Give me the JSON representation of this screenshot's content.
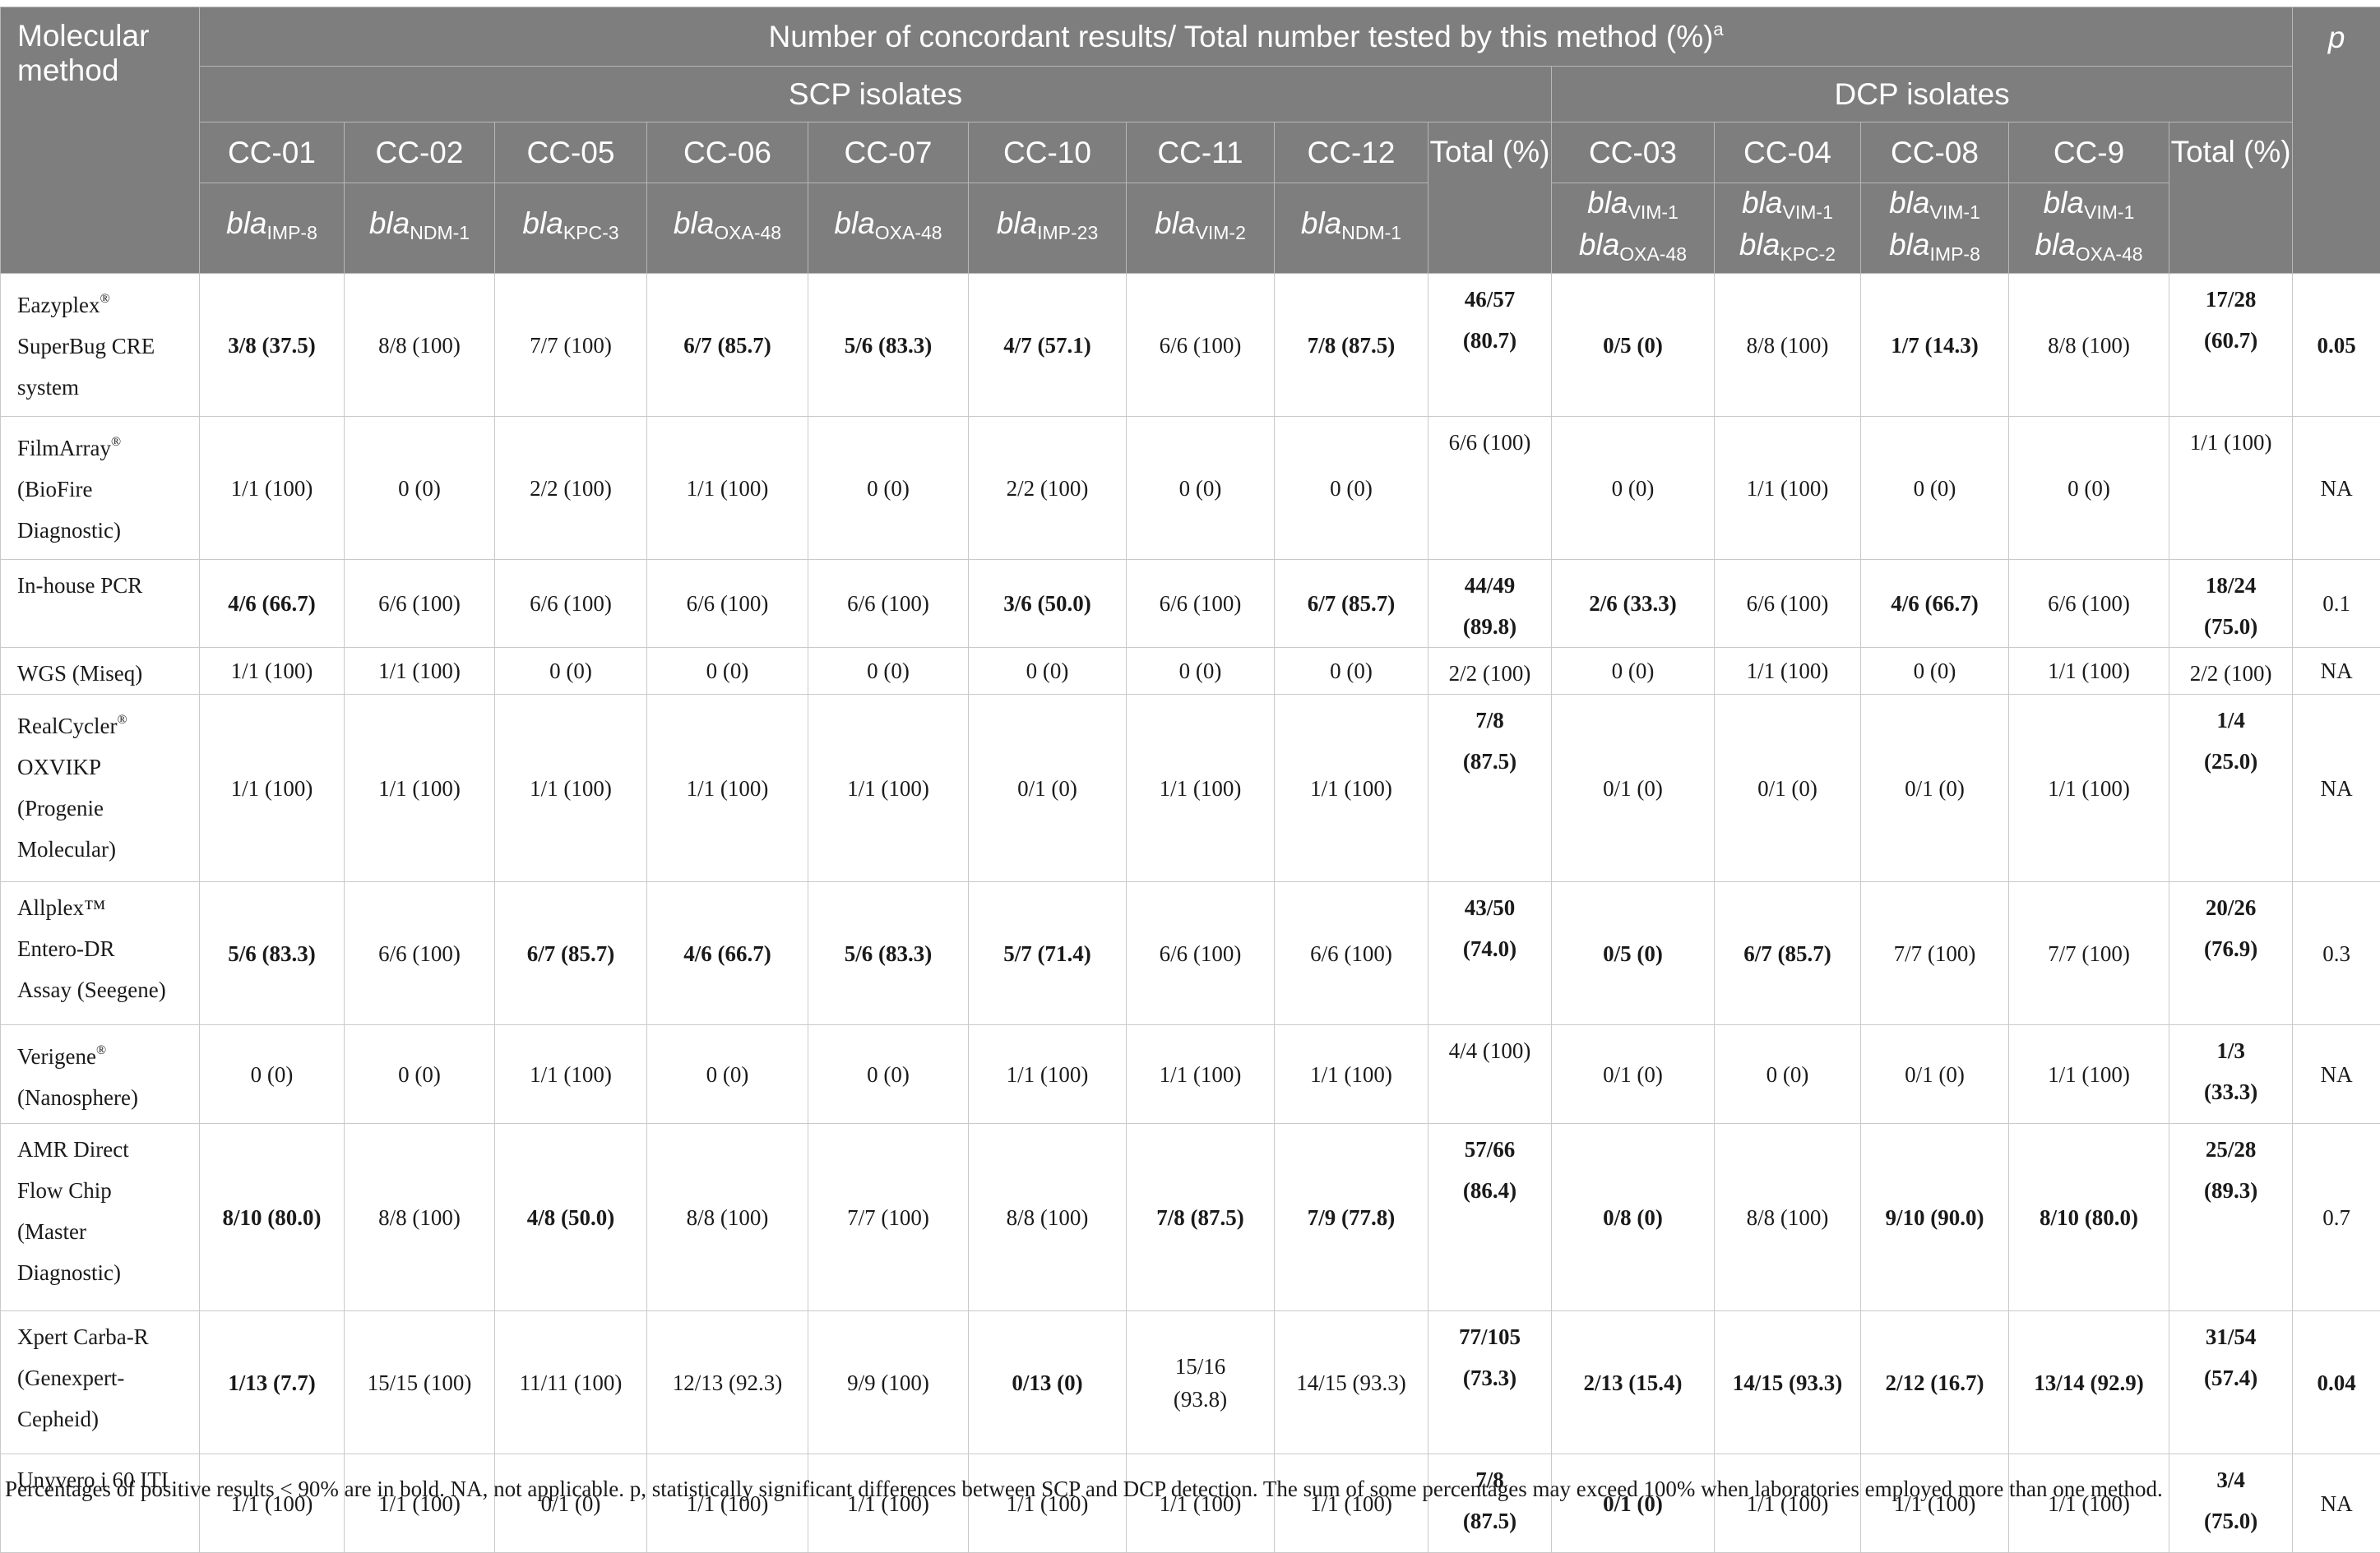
{
  "header": {
    "method_label": "Molecular method",
    "main_title": "Number of concordant results/ Total number tested by this method (%)",
    "main_title_sup": "a",
    "p_label": "p",
    "scp_label": "SCP isolates",
    "dcp_label": "DCP isolates",
    "total_label": "Total (%)",
    "gene_prefix": "bla",
    "scp_columns": [
      {
        "code": "CC-01",
        "genes": [
          "IMP-8"
        ]
      },
      {
        "code": "CC-02",
        "genes": [
          "NDM-1"
        ]
      },
      {
        "code": "CC-05",
        "genes": [
          "KPC-3"
        ]
      },
      {
        "code": "CC-06",
        "genes": [
          "OXA-48"
        ]
      },
      {
        "code": "CC-07",
        "genes": [
          "OXA-48"
        ]
      },
      {
        "code": "CC-10",
        "genes": [
          "IMP-23"
        ]
      },
      {
        "code": "CC-11",
        "genes": [
          "VIM-2"
        ]
      },
      {
        "code": "CC-12",
        "genes": [
          "NDM-1"
        ]
      }
    ],
    "dcp_columns": [
      {
        "code": "CC-03",
        "genes": [
          "VIM-1",
          "OXA-48"
        ]
      },
      {
        "code": "CC-04",
        "genes": [
          "VIM-1",
          "KPC-2"
        ]
      },
      {
        "code": "CC-08",
        "genes": [
          "VIM-1",
          "IMP-8"
        ]
      },
      {
        "code": "CC-9",
        "genes": [
          "VIM-1",
          "OXA-48"
        ]
      }
    ]
  },
  "rows": [
    {
      "method": [
        "Eazyplex",
        "SuperBug CRE",
        "system"
      ],
      "reg_after_first": true,
      "scp": [
        {
          "t": "3/8 (37.5)",
          "b": true
        },
        {
          "t": "8/8 (100)",
          "b": false
        },
        {
          "t": "7/7 (100)",
          "b": false
        },
        {
          "t": "6/7 (85.7)",
          "b": true
        },
        {
          "t": "5/6 (83.3)",
          "b": true
        },
        {
          "t": "4/7 (57.1)",
          "b": true
        },
        {
          "t": "6/6 (100)",
          "b": false
        },
        {
          "t": "7/8 (87.5)",
          "b": true
        }
      ],
      "scp_total": {
        "lines": [
          "46/57",
          "(80.7)"
        ],
        "b": true
      },
      "dcp": [
        {
          "t": "0/5 (0)",
          "b": true
        },
        {
          "t": "8/8 (100)",
          "b": false
        },
        {
          "t": "1/7 (14.3)",
          "b": true
        },
        {
          "t": "8/8 (100)",
          "b": false
        }
      ],
      "dcp_total": {
        "lines": [
          "17/28",
          "(60.7)"
        ],
        "b": true
      },
      "p": {
        "t": "0.05",
        "b": true
      }
    },
    {
      "method": [
        "FilmArray",
        "(BioFire",
        "Diagnostic)"
      ],
      "reg_after_first": true,
      "scp": [
        {
          "t": "1/1 (100)",
          "b": false
        },
        {
          "t": "0 (0)",
          "b": false
        },
        {
          "t": "2/2 (100)",
          "b": false
        },
        {
          "t": "1/1 (100)",
          "b": false
        },
        {
          "t": "0 (0)",
          "b": false
        },
        {
          "t": "2/2 (100)",
          "b": false
        },
        {
          "t": "0 (0)",
          "b": false
        },
        {
          "t": "0 (0)",
          "b": false
        }
      ],
      "scp_total": {
        "lines": [
          "6/6 (100)"
        ],
        "b": false
      },
      "dcp": [
        {
          "t": "0 (0)",
          "b": false
        },
        {
          "t": "1/1 (100)",
          "b": false
        },
        {
          "t": "0 (0)",
          "b": false
        },
        {
          "t": "0 (0)",
          "b": false
        }
      ],
      "dcp_total": {
        "lines": [
          "1/1 (100)"
        ],
        "b": false
      },
      "p": {
        "t": "NA",
        "b": false
      }
    },
    {
      "method": [
        "In-house PCR"
      ],
      "reg_after_first": false,
      "scp": [
        {
          "t": "4/6 (66.7)",
          "b": true
        },
        {
          "t": "6/6 (100)",
          "b": false
        },
        {
          "t": "6/6 (100)",
          "b": false
        },
        {
          "t": "6/6 (100)",
          "b": false
        },
        {
          "t": "6/6 (100)",
          "b": false
        },
        {
          "t": "3/6 (50.0)",
          "b": true
        },
        {
          "t": "6/6 (100)",
          "b": false
        },
        {
          "t": "6/7 (85.7)",
          "b": true
        }
      ],
      "scp_total": {
        "lines": [
          "44/49",
          "(89.8)"
        ],
        "b": true
      },
      "dcp": [
        {
          "t": "2/6 (33.3)",
          "b": true
        },
        {
          "t": "6/6 (100)",
          "b": false
        },
        {
          "t": "4/6 (66.7)",
          "b": true
        },
        {
          "t": "6/6 (100)",
          "b": false
        }
      ],
      "dcp_total": {
        "lines": [
          "18/24",
          "(75.0)"
        ],
        "b": true
      },
      "p": {
        "t": "0.1",
        "b": false
      }
    },
    {
      "method": [
        "WGS (Miseq)"
      ],
      "reg_after_first": false,
      "scp": [
        {
          "t": "1/1 (100)",
          "b": false
        },
        {
          "t": "1/1 (100)",
          "b": false
        },
        {
          "t": "0 (0)",
          "b": false
        },
        {
          "t": "0 (0)",
          "b": false
        },
        {
          "t": "0 (0)",
          "b": false
        },
        {
          "t": "0 (0)",
          "b": false
        },
        {
          "t": "0 (0)",
          "b": false
        },
        {
          "t": "0 (0)",
          "b": false
        }
      ],
      "scp_total": {
        "lines": [
          "2/2 (100)"
        ],
        "b": false
      },
      "dcp": [
        {
          "t": "0 (0)",
          "b": false
        },
        {
          "t": "1/1 (100)",
          "b": false
        },
        {
          "t": "0 (0)",
          "b": false
        },
        {
          "t": "1/1 (100)",
          "b": false
        }
      ],
      "dcp_total": {
        "lines": [
          "2/2 (100)"
        ],
        "b": false
      },
      "p": {
        "t": "NA",
        "b": false
      }
    },
    {
      "method": [
        "RealCycler",
        "OXVIKP",
        "(Progenie",
        "Molecular)"
      ],
      "reg_after_first": true,
      "scp": [
        {
          "t": "1/1 (100)",
          "b": false
        },
        {
          "t": "1/1 (100)",
          "b": false
        },
        {
          "t": "1/1 (100)",
          "b": false
        },
        {
          "t": "1/1 (100)",
          "b": false
        },
        {
          "t": "1/1 (100)",
          "b": false
        },
        {
          "t": "0/1 (0)",
          "b": false
        },
        {
          "t": "1/1 (100)",
          "b": false
        },
        {
          "t": "1/1 (100)",
          "b": false
        }
      ],
      "scp_total": {
        "lines": [
          "7/8",
          "(87.5)"
        ],
        "b": true
      },
      "dcp": [
        {
          "t": "0/1 (0)",
          "b": false
        },
        {
          "t": "0/1 (0)",
          "b": false
        },
        {
          "t": "0/1 (0)",
          "b": false
        },
        {
          "t": "1/1 (100)",
          "b": false
        }
      ],
      "dcp_total": {
        "lines": [
          "1/4",
          "(25.0)"
        ],
        "b": true
      },
      "p": {
        "t": "NA",
        "b": false
      }
    },
    {
      "method": [
        "Allplex™",
        "Entero-DR",
        "Assay (Seegene)"
      ],
      "reg_after_first": false,
      "scp": [
        {
          "t": "5/6 (83.3)",
          "b": true
        },
        {
          "t": "6/6 (100)",
          "b": false
        },
        {
          "t": "6/7 (85.7)",
          "b": true
        },
        {
          "t": "4/6 (66.7)",
          "b": true
        },
        {
          "t": "5/6 (83.3)",
          "b": true
        },
        {
          "t": "5/7 (71.4)",
          "b": true
        },
        {
          "t": "6/6 (100)",
          "b": false
        },
        {
          "t": "6/6 (100)",
          "b": false
        }
      ],
      "scp_total": {
        "lines": [
          "43/50",
          "(74.0)"
        ],
        "b": true
      },
      "dcp": [
        {
          "t": "0/5 (0)",
          "b": true
        },
        {
          "t": "6/7 (85.7)",
          "b": true
        },
        {
          "t": "7/7 (100)",
          "b": false
        },
        {
          "t": "7/7 (100)",
          "b": false
        }
      ],
      "dcp_total": {
        "lines": [
          "20/26",
          "(76.9)"
        ],
        "b": true
      },
      "p": {
        "t": "0.3",
        "b": false
      }
    },
    {
      "method": [
        "Verigene",
        "(Nanosphere)"
      ],
      "reg_after_first": true,
      "scp": [
        {
          "t": "0 (0)",
          "b": false
        },
        {
          "t": "0 (0)",
          "b": false
        },
        {
          "t": "1/1 (100)",
          "b": false
        },
        {
          "t": "0 (0)",
          "b": false
        },
        {
          "t": "0 (0)",
          "b": false
        },
        {
          "t": "1/1 (100)",
          "b": false
        },
        {
          "t": "1/1 (100)",
          "b": false
        },
        {
          "t": "1/1 (100)",
          "b": false
        }
      ],
      "scp_total": {
        "lines": [
          "4/4 (100)"
        ],
        "b": false
      },
      "dcp": [
        {
          "t": "0/1 (0)",
          "b": false
        },
        {
          "t": "0 (0)",
          "b": false
        },
        {
          "t": "0/1 (0)",
          "b": false
        },
        {
          "t": "1/1 (100)",
          "b": false
        }
      ],
      "dcp_total": {
        "lines": [
          "1/3",
          "(33.3)"
        ],
        "b": true
      },
      "p": {
        "t": "NA",
        "b": false
      }
    },
    {
      "method": [
        "AMR Direct",
        "Flow Chip",
        "(Master",
        "Diagnostic)"
      ],
      "reg_after_first": false,
      "scp": [
        {
          "t": "8/10 (80.0)",
          "b": true
        },
        {
          "t": "8/8 (100)",
          "b": false
        },
        {
          "t": "4/8 (50.0)",
          "b": true
        },
        {
          "t": "8/8 (100)",
          "b": false
        },
        {
          "t": "7/7 (100)",
          "b": false
        },
        {
          "t": "8/8 (100)",
          "b": false
        },
        {
          "t": "7/8 (87.5)",
          "b": true
        },
        {
          "t": "7/9 (77.8)",
          "b": true
        }
      ],
      "scp_total": {
        "lines": [
          "57/66",
          "(86.4)"
        ],
        "b": true
      },
      "dcp": [
        {
          "t": "0/8 (0)",
          "b": true
        },
        {
          "t": "8/8 (100)",
          "b": false
        },
        {
          "t": "9/10 (90.0)",
          "b": true
        },
        {
          "t": "8/10 (80.0)",
          "b": true
        }
      ],
      "dcp_total": {
        "lines": [
          "25/28",
          "(89.3)"
        ],
        "b": true
      },
      "p": {
        "t": "0.7",
        "b": false
      }
    },
    {
      "method": [
        "Xpert Carba-R",
        "(Genexpert-",
        "Cepheid)"
      ],
      "reg_after_first": false,
      "scp": [
        {
          "t": "1/13 (7.7)",
          "b": true
        },
        {
          "t": "15/15 (100)",
          "b": false
        },
        {
          "t": "11/11 (100)",
          "b": false
        },
        {
          "t": "12/13 (92.3)",
          "b": false
        },
        {
          "t": "9/9 (100)",
          "b": false
        },
        {
          "t": "0/13 (0)",
          "b": true
        },
        {
          "t": "15/16 (93.8)",
          "b": false
        },
        {
          "t": "14/15 (93.3)",
          "b": false
        }
      ],
      "scp_total": {
        "lines": [
          "77/105",
          "(73.3)"
        ],
        "b": true
      },
      "dcp": [
        {
          "t": "2/13 (15.4)",
          "b": true
        },
        {
          "t": "14/15 (93.3)",
          "b": true
        },
        {
          "t": "2/12 (16.7)",
          "b": true
        },
        {
          "t": "13/14 (92.9)",
          "b": true
        }
      ],
      "dcp_total": {
        "lines": [
          "31/54",
          "(57.4)"
        ],
        "b": true
      },
      "p": {
        "t": "0.04",
        "b": true
      }
    },
    {
      "method": [
        "Unyvero i 60 ITI"
      ],
      "reg_after_first": false,
      "scp": [
        {
          "t": "1/1 (100)",
          "b": false
        },
        {
          "t": "1/1 (100)",
          "b": false
        },
        {
          "t": "0/1 (0)",
          "b": false
        },
        {
          "t": "1/1 (100)",
          "b": false
        },
        {
          "t": "1/1 (100)",
          "b": false
        },
        {
          "t": "1/1 (100)",
          "b": false
        },
        {
          "t": "1/1 (100)",
          "b": false
        },
        {
          "t": "1/1 (100)",
          "b": false
        }
      ],
      "scp_total": {
        "lines": [
          "7/8",
          "(87.5)"
        ],
        "b": true
      },
      "dcp": [
        {
          "t": "0/1 (0)",
          "b": true
        },
        {
          "t": "1/1 (100)",
          "b": false
        },
        {
          "t": "1/1 (100)",
          "b": false
        },
        {
          "t": "1/1 (100)",
          "b": false
        }
      ],
      "dcp_total": {
        "lines": [
          "3/4",
          "(75.0)"
        ],
        "b": true
      },
      "p": {
        "t": "NA",
        "b": false
      }
    }
  ],
  "reg_mark": "®",
  "footnote": "Percentages of positive results < 90% are in bold. NA, not applicable. p, statistically significant differences between SCP and DCP detection. The sum of some percentages may exceed 100% when laboratories employed more than one method."
}
